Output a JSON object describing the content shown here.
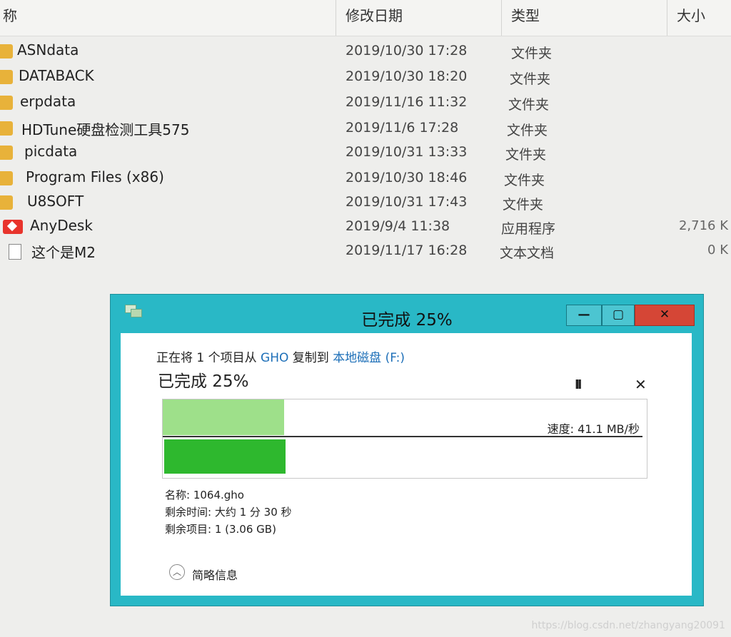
{
  "explorer": {
    "columns": {
      "name": "称",
      "date": "修改日期",
      "type": "类型",
      "size": "大小"
    },
    "files": [
      {
        "name": "ASNdata",
        "date": "2019/10/30 17:28",
        "type": "文件夹",
        "size": "",
        "icon": "folder-icon"
      },
      {
        "name": "DATABACK",
        "date": "2019/10/30 18:20",
        "type": "文件夹",
        "size": "",
        "icon": "folder-icon"
      },
      {
        "name": "erpdata",
        "date": "2019/11/16 11:32",
        "type": "文件夹",
        "size": "",
        "icon": "folder-icon"
      },
      {
        "name": "HDTune硬盘检测工具575",
        "date": "2019/11/6 17:28",
        "type": "文件夹",
        "size": "",
        "icon": "folder-icon"
      },
      {
        "name": "picdata",
        "date": "2019/10/31 13:33",
        "type": "文件夹",
        "size": "",
        "icon": "folder-icon"
      },
      {
        "name": "Program Files (x86)",
        "date": "2019/10/30 18:46",
        "type": "文件夹",
        "size": "",
        "icon": "folder-icon"
      },
      {
        "name": "U8SOFT",
        "date": "2019/10/31 17:43",
        "type": "文件夹",
        "size": "",
        "icon": "folder-icon"
      },
      {
        "name": "AnyDesk",
        "date": "2019/9/4 11:38",
        "type": "应用程序",
        "size": "2,716 K",
        "icon": "anydesk-icon"
      },
      {
        "name": "这个是M2",
        "date": "2019/11/17 16:28",
        "type": "文本文档",
        "size": "0 K",
        "icon": "text-file-icon"
      }
    ]
  },
  "dialog": {
    "title": "已完成 25%",
    "buttons": {
      "minimize": "—",
      "maximize": "▢",
      "close": "✕"
    },
    "desc": {
      "prefix": "正在将 1 个项目从 ",
      "source": "GHO",
      "middle": " 复制到 ",
      "target": "本地磁盘",
      "suffix": " (F:)"
    },
    "status": "已完成 25%",
    "pause_icon": "II",
    "cancel_icon": "✕",
    "progress": 0.25,
    "speed": "速度: 41.1 MB/秒",
    "name_line": "名称: 1064.gho",
    "time_line": "剩余时间: 大约 1 分 30 秒",
    "items_line": "剩余项目: 1 (3.06 GB)",
    "details_icon": "︿",
    "details_label": "简略信息"
  },
  "watermark": "https://blog.csdn.net/zhangyang20091"
}
